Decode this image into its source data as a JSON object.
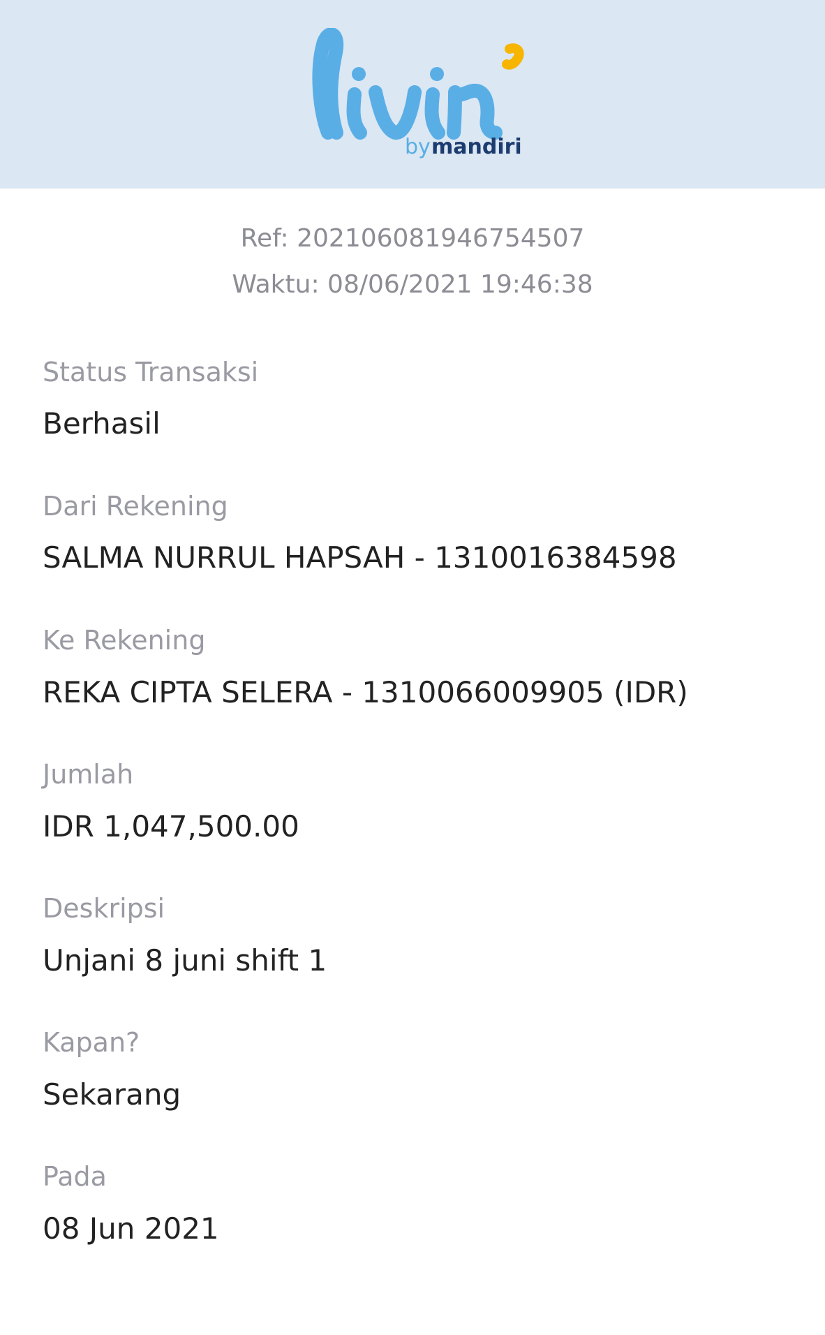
{
  "header": {
    "logo": {
      "wordmark": "livin'",
      "by": "by",
      "brand": "mandiri"
    },
    "colors": {
      "background": "#dbe7f2",
      "logo_blue": "#5aaee6",
      "apostrophe_yellow": "#f7b500",
      "mandiri_navy": "#1c3b6f"
    }
  },
  "receipt": {
    "ref": "Ref: 202106081946754507",
    "time": "Waktu: 08/06/2021 19:46:38",
    "fields": [
      {
        "label": "Status Transaksi",
        "value": "Berhasil"
      },
      {
        "label": "Dari Rekening",
        "value": "SALMA NURRUL HAPSAH - 1310016384598"
      },
      {
        "label": "Ke Rekening",
        "value": "REKA CIPTA SELERA - 1310066009905 (IDR)"
      },
      {
        "label": "Jumlah",
        "value": "IDR 1,047,500.00"
      },
      {
        "label": "Deskripsi",
        "value": "Unjani 8 juni shift 1"
      },
      {
        "label": "Kapan?",
        "value": "Sekarang"
      },
      {
        "label": "Pada",
        "value": "08 Jun 2021"
      }
    ]
  }
}
